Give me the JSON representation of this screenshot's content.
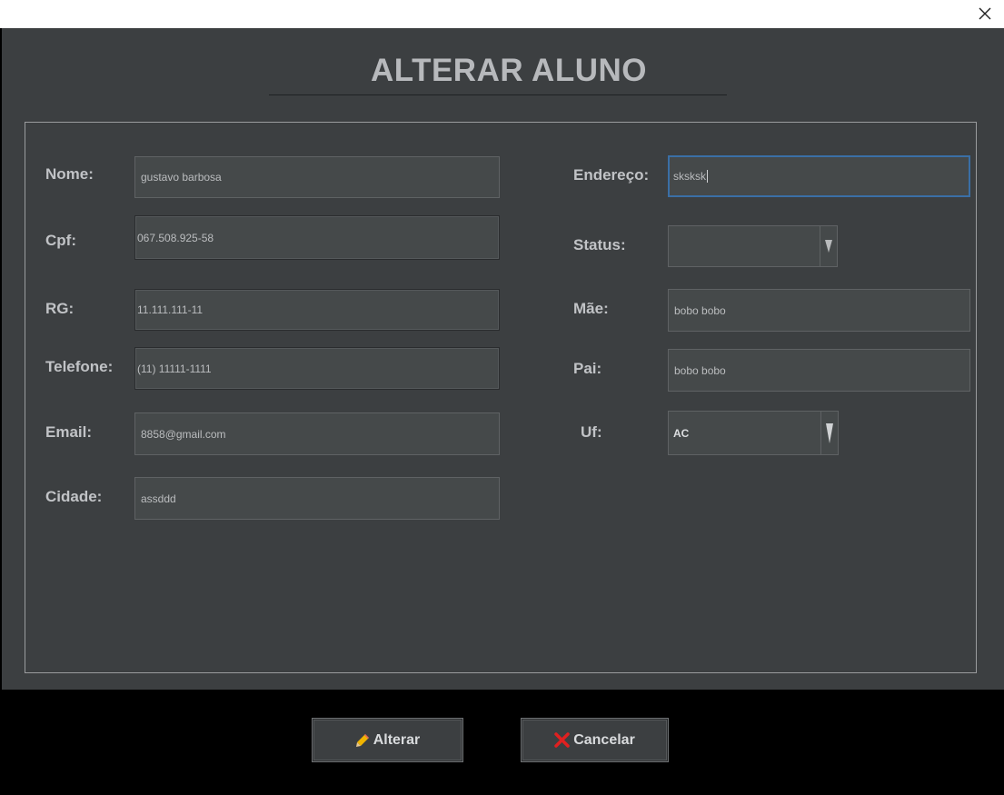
{
  "window": {
    "close_icon": "close-icon"
  },
  "title": "ALTERAR ALUNO",
  "labels": {
    "nome": "Nome:",
    "cpf": "Cpf:",
    "rg": "RG:",
    "telefone": "Telefone:",
    "email": "Email:",
    "cidade": "Cidade:",
    "endereco": "Endereço:",
    "status": "Status:",
    "mae": "Mãe:",
    "pai": "Pai:",
    "uf": "Uf:"
  },
  "values": {
    "nome": "gustavo barbosa",
    "cpf": "067.508.925-58",
    "rg": "11.111.111-11",
    "telefone": "(11) 11111-1111",
    "email": "8858@gmail.com",
    "cidade": "assddd",
    "endereco": "sksksk",
    "status": "",
    "mae": "bobo bobo",
    "pai": "bobo bobo",
    "uf": "AC"
  },
  "buttons": {
    "alterar": {
      "label": "Alterar",
      "icon": "pencil-icon"
    },
    "cancelar": {
      "label": "Cancelar",
      "icon": "red-x-icon"
    }
  },
  "colors": {
    "background": "#3c3f41",
    "field_bg": "#45494a",
    "focus_border": "#3a6fa6",
    "cancel_icon": "#e02020"
  }
}
